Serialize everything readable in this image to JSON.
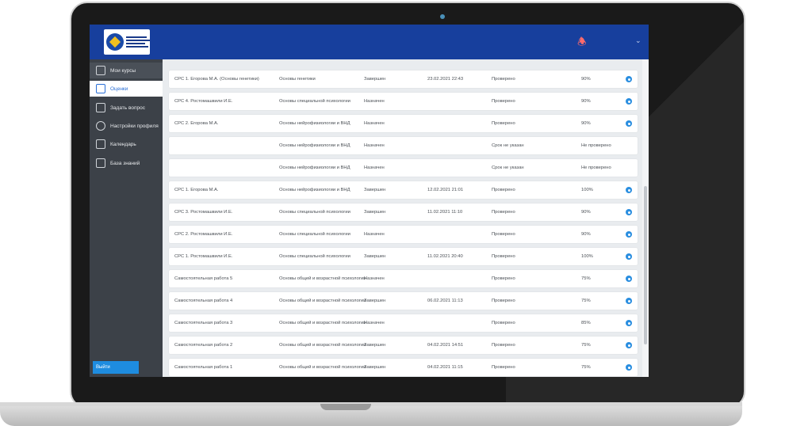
{
  "nav": {
    "items": [
      {
        "label": "Мои курсы"
      },
      {
        "label": "Оценки"
      },
      {
        "label": "Задать вопрос"
      },
      {
        "label": "Настройки профиля"
      },
      {
        "label": "Календарь"
      },
      {
        "label": "База знаний"
      }
    ],
    "exit_label": "Выйти"
  },
  "table": {
    "rows": [
      {
        "work": "СРС 1. Егорова М.А. (Основы генетики)",
        "course": "Основы генетики",
        "status": "Завершен",
        "date": "23.02.2021 22:43",
        "check": "Проверено",
        "grade": "90%",
        "view": true
      },
      {
        "work": "СРС 4. Ростомашвили И.Е.",
        "course": "Основы специальной психологии",
        "status": "Назначен",
        "date": "",
        "check": "Проверено",
        "grade": "90%",
        "view": true
      },
      {
        "work": "СРС 2. Егорова М.А.",
        "course": "Основы нейрофизиологии и ВНД",
        "status": "Назначен",
        "date": "",
        "check": "Проверено",
        "grade": "90%",
        "view": true
      },
      {
        "work": "",
        "course": "Основы нейрофизиологии и ВНД",
        "status": "Назначен",
        "date": "",
        "check": "Срок не указан",
        "grade": "Не проверено",
        "view": false
      },
      {
        "work": "",
        "course": "Основы нейрофизиологии и ВНД",
        "status": "Назначен",
        "date": "",
        "check": "Срок не указан",
        "grade": "Не проверено",
        "view": false
      },
      {
        "work": "СРС 1. Егорова М.А.",
        "course": "Основы нейрофизиологии и ВНД",
        "status": "Завершен",
        "date": "12.02.2021 21:01",
        "check": "Проверено",
        "grade": "100%",
        "view": true
      },
      {
        "work": "СРС 3. Ростомашвили И.Е.",
        "course": "Основы специальной психологии",
        "status": "Завершен",
        "date": "11.02.2021 11:10",
        "check": "Проверено",
        "grade": "90%",
        "view": true
      },
      {
        "work": "СРС 2. Ростомашвили И.Е.",
        "course": "Основы специальной психологии",
        "status": "Назначен",
        "date": "",
        "check": "Проверено",
        "grade": "90%",
        "view": true
      },
      {
        "work": "СРС 1. Ростомашвили И.Е.",
        "course": "Основы специальной психологии",
        "status": "Завершен",
        "date": "11.02.2021 20:40",
        "check": "Проверено",
        "grade": "100%",
        "view": true
      },
      {
        "work": "Самостоятельная работа 5",
        "course": "Основы общей и возрастной психологии",
        "status": "Назначен",
        "date": "",
        "check": "Проверено",
        "grade": "75%",
        "view": true
      },
      {
        "work": "Самостоятельная работа 4",
        "course": "Основы общей и возрастной психологии",
        "status": "Завершен",
        "date": "06.02.2021 11:13",
        "check": "Проверено",
        "grade": "75%",
        "view": true
      },
      {
        "work": "Самостоятельная работа 3",
        "course": "Основы общей и возрастной психологии",
        "status": "Назначен",
        "date": "",
        "check": "Проверено",
        "grade": "85%",
        "view": true
      },
      {
        "work": "Самостоятельная работа 2",
        "course": "Основы общей и возрастной психологии",
        "status": "Завершен",
        "date": "04.02.2021 14:51",
        "check": "Проверено",
        "grade": "75%",
        "view": true
      },
      {
        "work": "Самостоятельная работа 1",
        "course": "Основы общей и возрастной психологии",
        "status": "Завершен",
        "date": "04.02.2021 11:15",
        "check": "Проверено",
        "grade": "75%",
        "view": true
      }
    ]
  },
  "colors": {
    "header": "#173f9d",
    "sidebar": "#3c4148",
    "accent": "#2a8ee0",
    "notification": "#ff6b6b"
  },
  "icons": {
    "notification": "bell-icon",
    "view": "eye-icon"
  }
}
